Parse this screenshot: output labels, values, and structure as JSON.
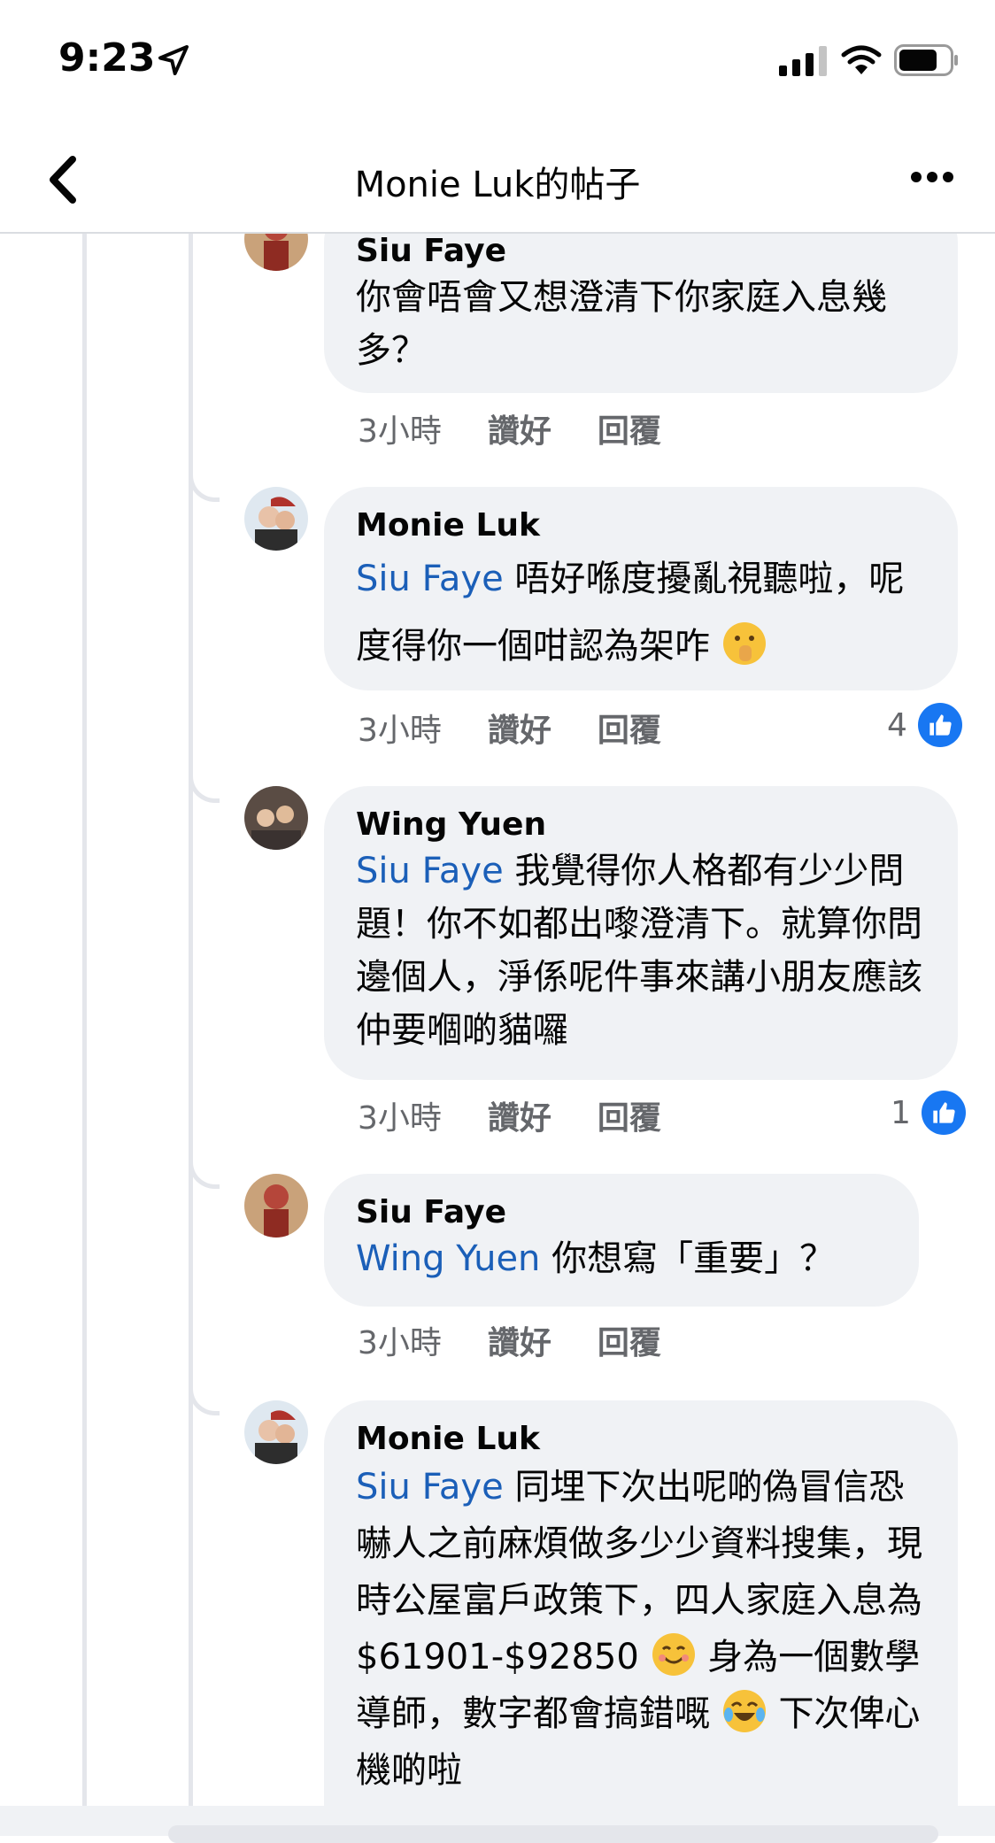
{
  "status_bar": {
    "time": "9:23"
  },
  "header": {
    "title": "Monie Luk的帖子"
  },
  "comments": [
    {
      "author": "Siu Faye",
      "mention": "",
      "text": "你會唔會又想澄清下你家庭入息幾多？",
      "time": "3小時",
      "like_label": "讚好",
      "reply_label": "回覆",
      "reactions": ""
    },
    {
      "author": "Monie Luk",
      "mention": "Siu Faye",
      "text": "唔好喺度擾亂視聽啦，呢度得你一個咁認為架咋",
      "emoji": "shushing-face",
      "time": "3小時",
      "like_label": "讚好",
      "reply_label": "回覆",
      "reactions": "4"
    },
    {
      "author": "Wing Yuen",
      "mention": "Siu Faye",
      "text": "我覺得你人格都有少少問題！你不如都出嚟澄清下。就算你問邊個人，淨係呢件事來講小朋友應該仲要嗰啲貓囉",
      "time": "3小時",
      "like_label": "讚好",
      "reply_label": "回覆",
      "reactions": "1"
    },
    {
      "author": "Siu Faye",
      "mention": "Wing Yuen",
      "text": "你想寫「重要」？",
      "time": "3小時",
      "like_label": "讚好",
      "reply_label": "回覆",
      "reactions": ""
    },
    {
      "author": "Monie Luk",
      "mention": "Siu Faye",
      "text_a": "同埋下次出呢啲偽冒信恐嚇人之前麻煩做多少少資料搜集，現時公屋富戶政策下，四人家庭入息為$61901-$92850",
      "text_b": "身為一個數學導師，數字都會搞錯嘅",
      "text_c": "下次俾心機啲啦",
      "emoji_a": "smiling-face",
      "emoji_b": "tears-of-joy-face"
    }
  ],
  "colors": {
    "mention": "#1b5fb8",
    "like_blue": "#1877f2",
    "bubble": "#f0f2f5"
  }
}
